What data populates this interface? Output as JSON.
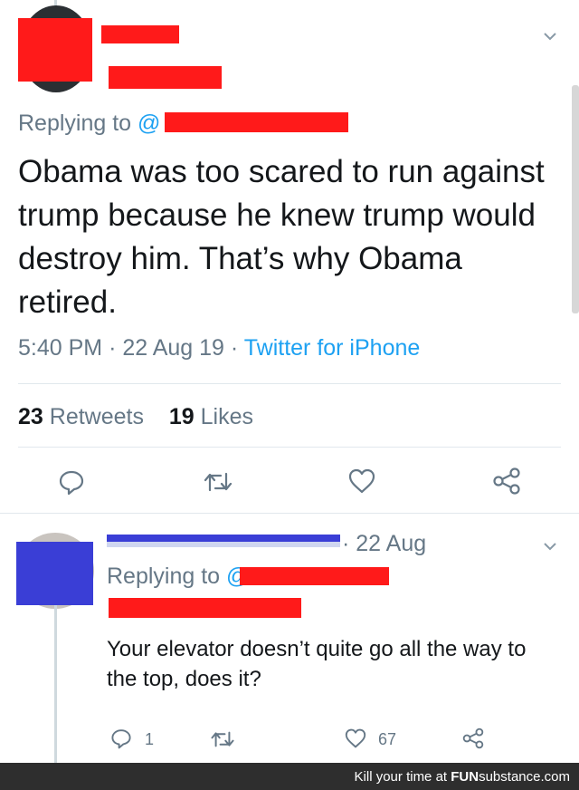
{
  "tweet": {
    "replying_label": "Replying to",
    "replying_handle": "@",
    "text": "Obama was too scared to run against trump because he knew trump would destroy him. That’s why Obama retired.",
    "time": "5:40 PM",
    "date": "22 Aug 19",
    "source": "Twitter for iPhone",
    "retweets_count": "23",
    "retweets_label": "Retweets",
    "likes_count": "19",
    "likes_label": "Likes"
  },
  "reply": {
    "date": "· 22 Aug",
    "replying_label": "Replying to",
    "replying_handle": "@",
    "text": "Your elevator doesn’t quite go all the way to the top, does it?",
    "reply_count": "1",
    "like_count": "67"
  },
  "footer": {
    "prefix": "Kill your time at",
    "brand": "FUN",
    "brand_sub": "substance",
    "suffix": ".com"
  },
  "colors": {
    "redaction_red": "#ff1a1a",
    "redaction_blue": "#3a3ed6",
    "link_blue": "#1da1f2",
    "meta_gray": "#657786"
  }
}
